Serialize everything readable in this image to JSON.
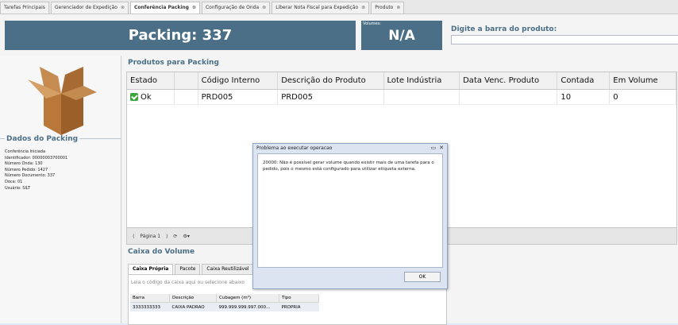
{
  "tabs": [
    {
      "label": "Tarefas Principais",
      "close": ""
    },
    {
      "label": "Gerenciador de Expedição",
      "close": "⊗"
    },
    {
      "label": "Conferência Packing",
      "close": "⊗",
      "active": true
    },
    {
      "label": "Configuração de Onda",
      "close": "⊗"
    },
    {
      "label": "Liberar Nota Fiscal para Expedição",
      "close": "⊗"
    },
    {
      "label": "Produto",
      "close": "⊗"
    }
  ],
  "header": {
    "packing_title": "Packing: 337",
    "volumes_label": "Volumes:",
    "volumes_value": "N/A",
    "barcode_label": "Digite a barra do produto:",
    "barcode_value": ""
  },
  "dados": {
    "title": "Dados do Packing",
    "lines": [
      "Conferência Iniciada",
      "Identificador: 00000003700001",
      "Número Onda: 130",
      "Número Pedido: 1427",
      "Número Documento: 337",
      "Doca: 01",
      "Usuário: SILT"
    ]
  },
  "produtos": {
    "title": "Produtos para Packing",
    "columns": [
      "Estado",
      "",
      "Código Interno",
      "Descrição do Produto",
      "Lote Indústria",
      "Data Venc. Produto",
      "Contada",
      "Em Volume"
    ],
    "rows": [
      {
        "estado": "Ok",
        "extra": "",
        "codigo": "PRD005",
        "descricao": "PRD005",
        "lote": "",
        "data": "",
        "contada": "10",
        "volume": "0"
      }
    ]
  },
  "pager": {
    "page_label": "Página 1",
    "first": "⟨",
    "prev": "⟩",
    "refresh": "⟳",
    "settings": "⚙▾"
  },
  "caixa": {
    "title": "Caixa do Volume",
    "tabs": [
      "Caixa Própria",
      "Pacote",
      "Caixa Reutilizável"
    ],
    "hint": "Leia o código da caixa aqui ou selecione abaixo",
    "columns": [
      "Barra",
      "Descrição",
      "Cubagem (m³)",
      "Tipo"
    ],
    "rows": [
      {
        "barra": "3333333333",
        "descricao": "CAIXA PADRAO",
        "cubagem": "999.999.999.997.000...",
        "tipo": "PROPRIA"
      }
    ]
  },
  "dialog": {
    "title": "Problema ao executar operacao",
    "message": "20000: Não é possível gerar volume quando existir mais de uma tarefa para o pedido, pois o mesmo está configurado para utilizar etiqueta externa.",
    "ok": "OK",
    "restore": "▭",
    "close": "✕"
  }
}
